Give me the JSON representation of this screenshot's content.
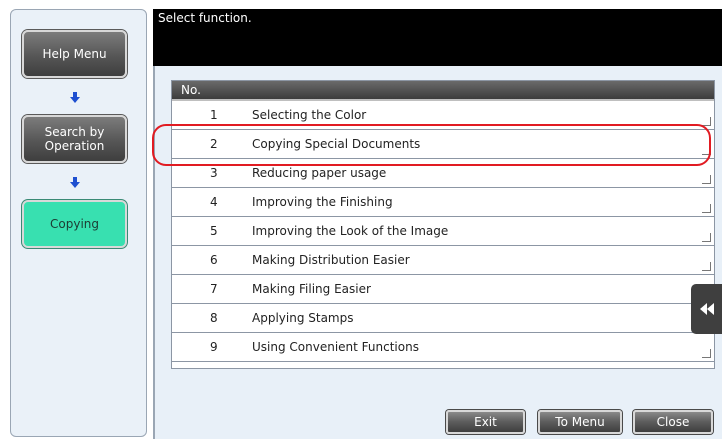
{
  "header": {
    "title": "Select function."
  },
  "nav": {
    "help_menu": "Help Menu",
    "search_by_operation": "Search by\nOperation",
    "copying": "Copying"
  },
  "table": {
    "column_header": "No.",
    "rows": [
      {
        "num": "1",
        "label": "Selecting the Color"
      },
      {
        "num": "2",
        "label": "Copying Special Documents"
      },
      {
        "num": "3",
        "label": "Reducing paper usage"
      },
      {
        "num": "4",
        "label": "Improving the Finishing"
      },
      {
        "num": "5",
        "label": "Improving the Look of the Image"
      },
      {
        "num": "6",
        "label": "Making Distribution Easier"
      },
      {
        "num": "7",
        "label": "Making Filing Easier"
      },
      {
        "num": "8",
        "label": "Applying Stamps"
      },
      {
        "num": "9",
        "label": "Using Convenient Functions"
      }
    ]
  },
  "buttons": {
    "exit": "Exit",
    "to_menu": "To Menu",
    "close": "Close"
  },
  "colors": {
    "active_nav": "#38e0b0",
    "highlight": "#e11b22",
    "arrow": "#1e4fd0",
    "header_bg": "#000000"
  },
  "icons": {
    "side_tab": "double-chevron-left-icon",
    "flow_arrow": "arrow-down-icon"
  }
}
